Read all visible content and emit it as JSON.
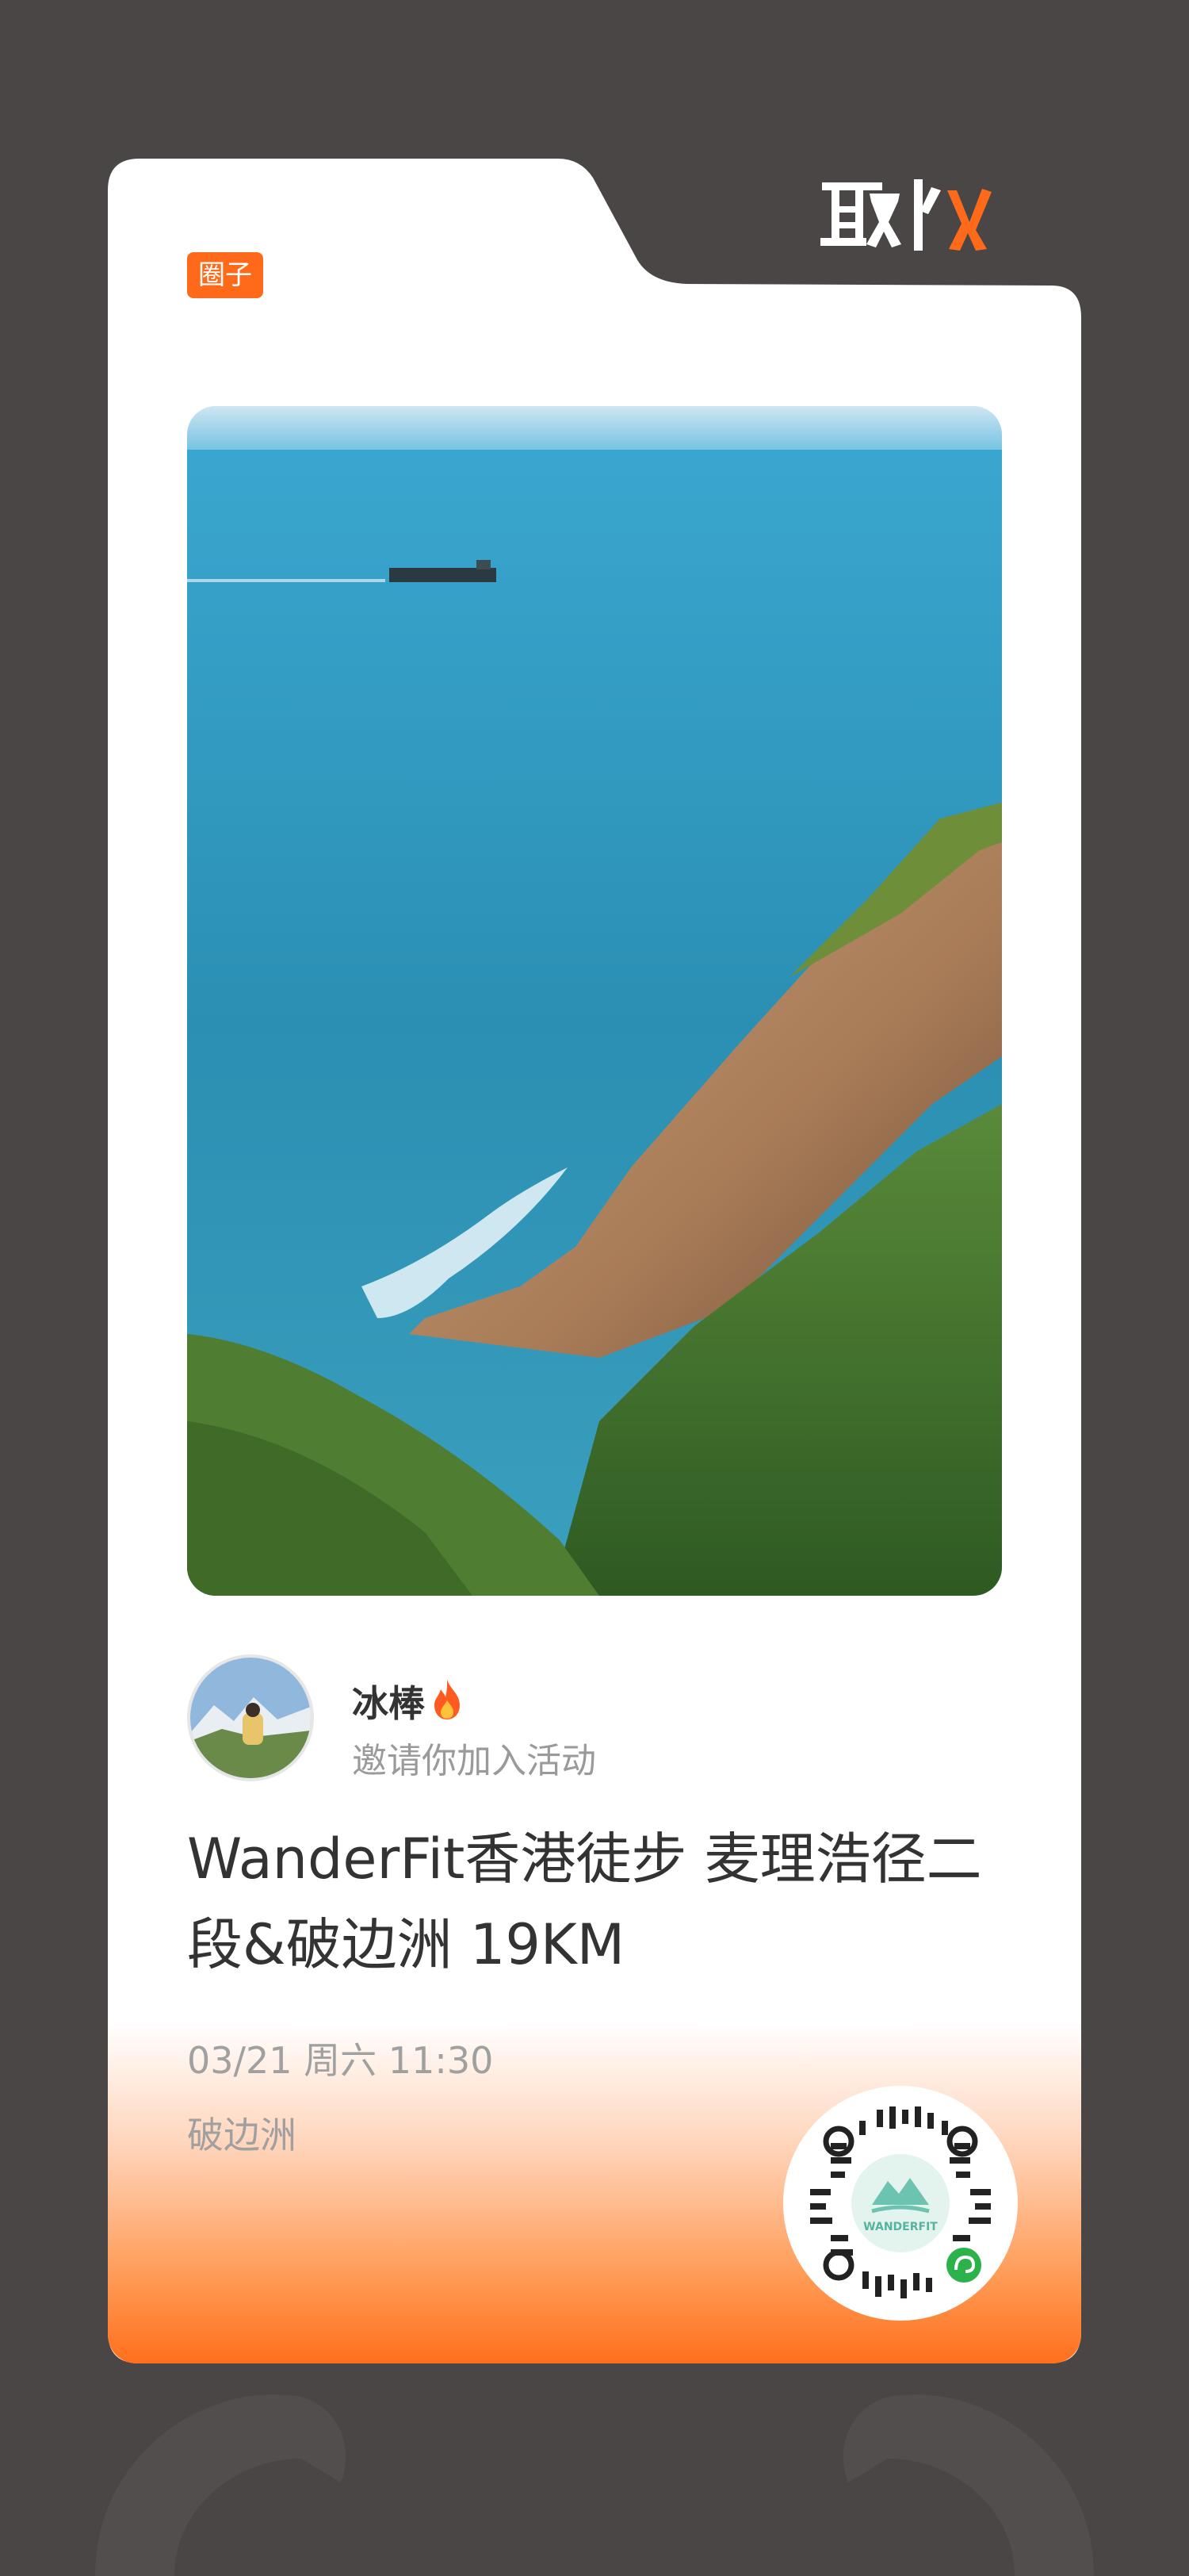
{
  "brand": {
    "logo_text": "取火"
  },
  "tag": {
    "label": "圈子"
  },
  "author": {
    "name": "冰棒",
    "subtitle": "邀请你加入活动"
  },
  "event": {
    "title": "WanderFit香港徒步 麦理浩径二段&破边洲 19KM",
    "datetime": "03/21 周六 11:30",
    "location": "破边洲"
  },
  "qrcode": {
    "brand_text": "WANDERFIT"
  },
  "colors": {
    "accent": "#ff6a1a",
    "background": "#4a4646",
    "card": "#ffffff"
  },
  "icons": [
    "fire-icon",
    "mini-program-icon"
  ]
}
